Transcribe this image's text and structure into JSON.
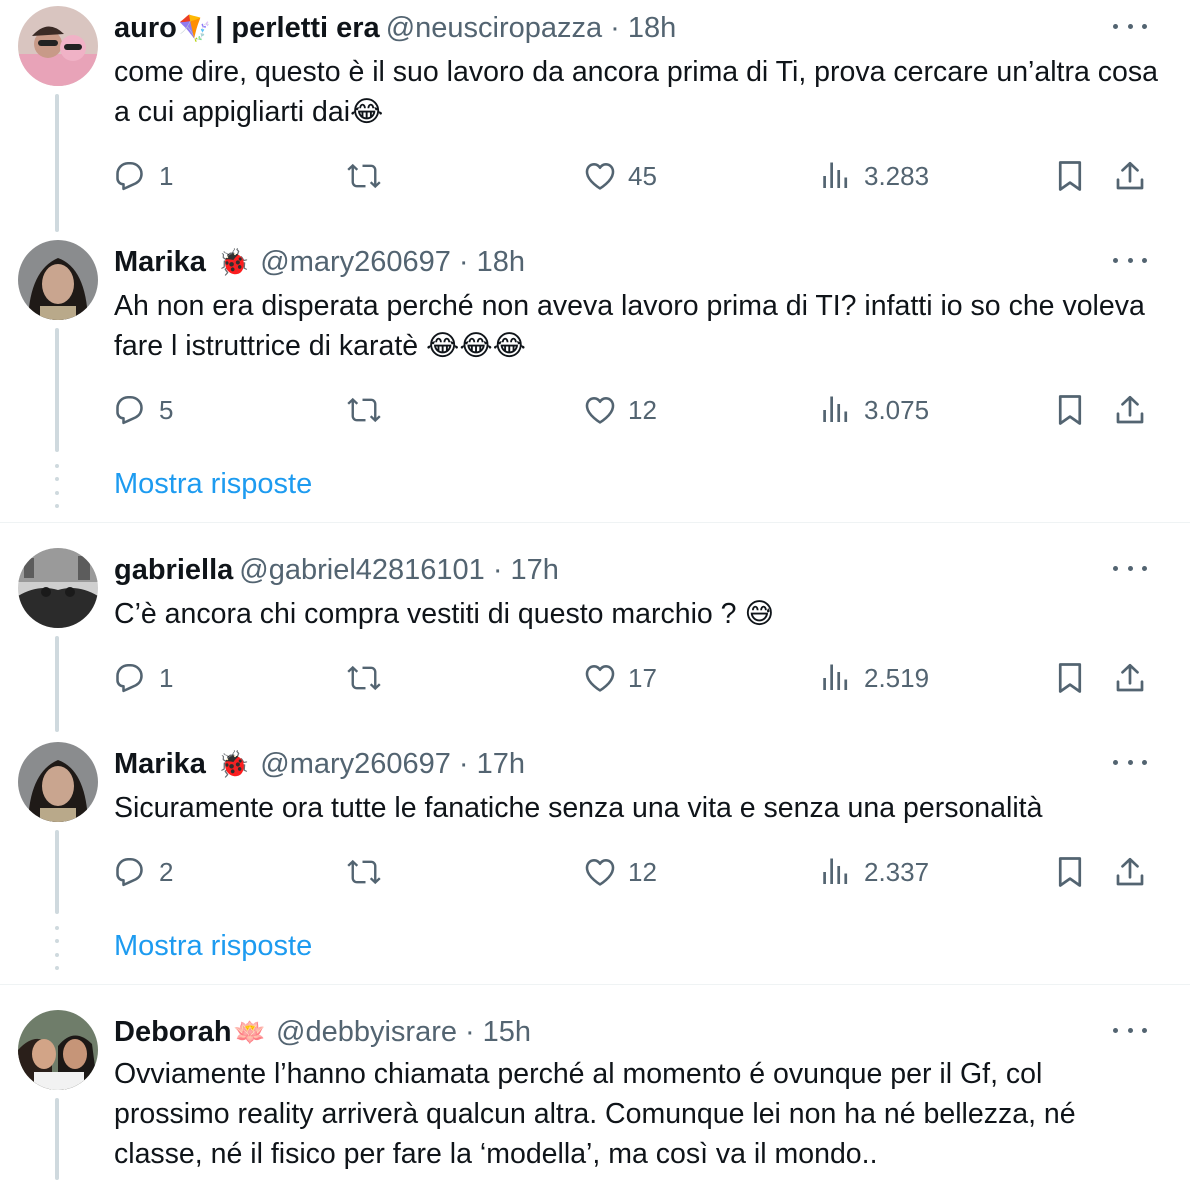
{
  "tweets": [
    {
      "name": "auro",
      "name_emoji": "🪁",
      "name_suffix": "| perletti era",
      "handle": "@neusciropazza",
      "dot": "·",
      "time": "18h",
      "text": "come dire, questo è il suo lavoro da ancora prima di Ti, prova cercare un’altra cosa a cui appigliarti dai😂",
      "replies": "1",
      "retweets": "",
      "likes": "45",
      "views": "3.283"
    },
    {
      "name": "Marika",
      "name_emoji": "🐞",
      "handle": "@mary260697",
      "dot": "·",
      "time": "18h",
      "text": "Ah non era disperata perché non aveva lavoro prima di TI? infatti io so che voleva fare l istruttrice di karatè 😂😂😂",
      "replies": "5",
      "retweets": "",
      "likes": "12",
      "views": "3.075"
    },
    {
      "name": "gabriella",
      "handle": "@gabriel42816101",
      "dot": "·",
      "time": "17h",
      "text": "C’è ancora chi compra vestiti di questo marchio ? 😅",
      "replies": "1",
      "retweets": "",
      "likes": "17",
      "views": "2.519"
    },
    {
      "name": "Marika",
      "name_emoji": "🐞",
      "handle": "@mary260697",
      "dot": "·",
      "time": "17h",
      "text": "Sicuramente ora tutte le fanatiche senza una vita e senza una personalità",
      "replies": "2",
      "retweets": "",
      "likes": "12",
      "views": "2.337"
    },
    {
      "name": "Deborah",
      "name_emoji": "🪷",
      "handle": "@debbyisrare",
      "dot": "·",
      "time": "15h",
      "text": "Ovviamente l’hanno chiamata perché al momento é ovunque per il Gf, col prossimo reality arriverà qualcun altra. Comunque lei non ha né bellezza, né classe, né il fisico per fare la ‘modella’, ma  così va il mondo.."
    }
  ],
  "show_replies_label": "Mostra risposte",
  "colors": {
    "text": "#0f1419",
    "secondary": "#536471",
    "link": "#1d9bf0",
    "thread_line": "#cfd9de",
    "divider": "#eff3f4"
  },
  "icons": {
    "reply": "reply-icon",
    "retweet": "retweet-icon",
    "like": "heart-icon",
    "views": "views-icon",
    "bookmark": "bookmark-icon",
    "share": "share-icon",
    "more": "more-icon"
  }
}
